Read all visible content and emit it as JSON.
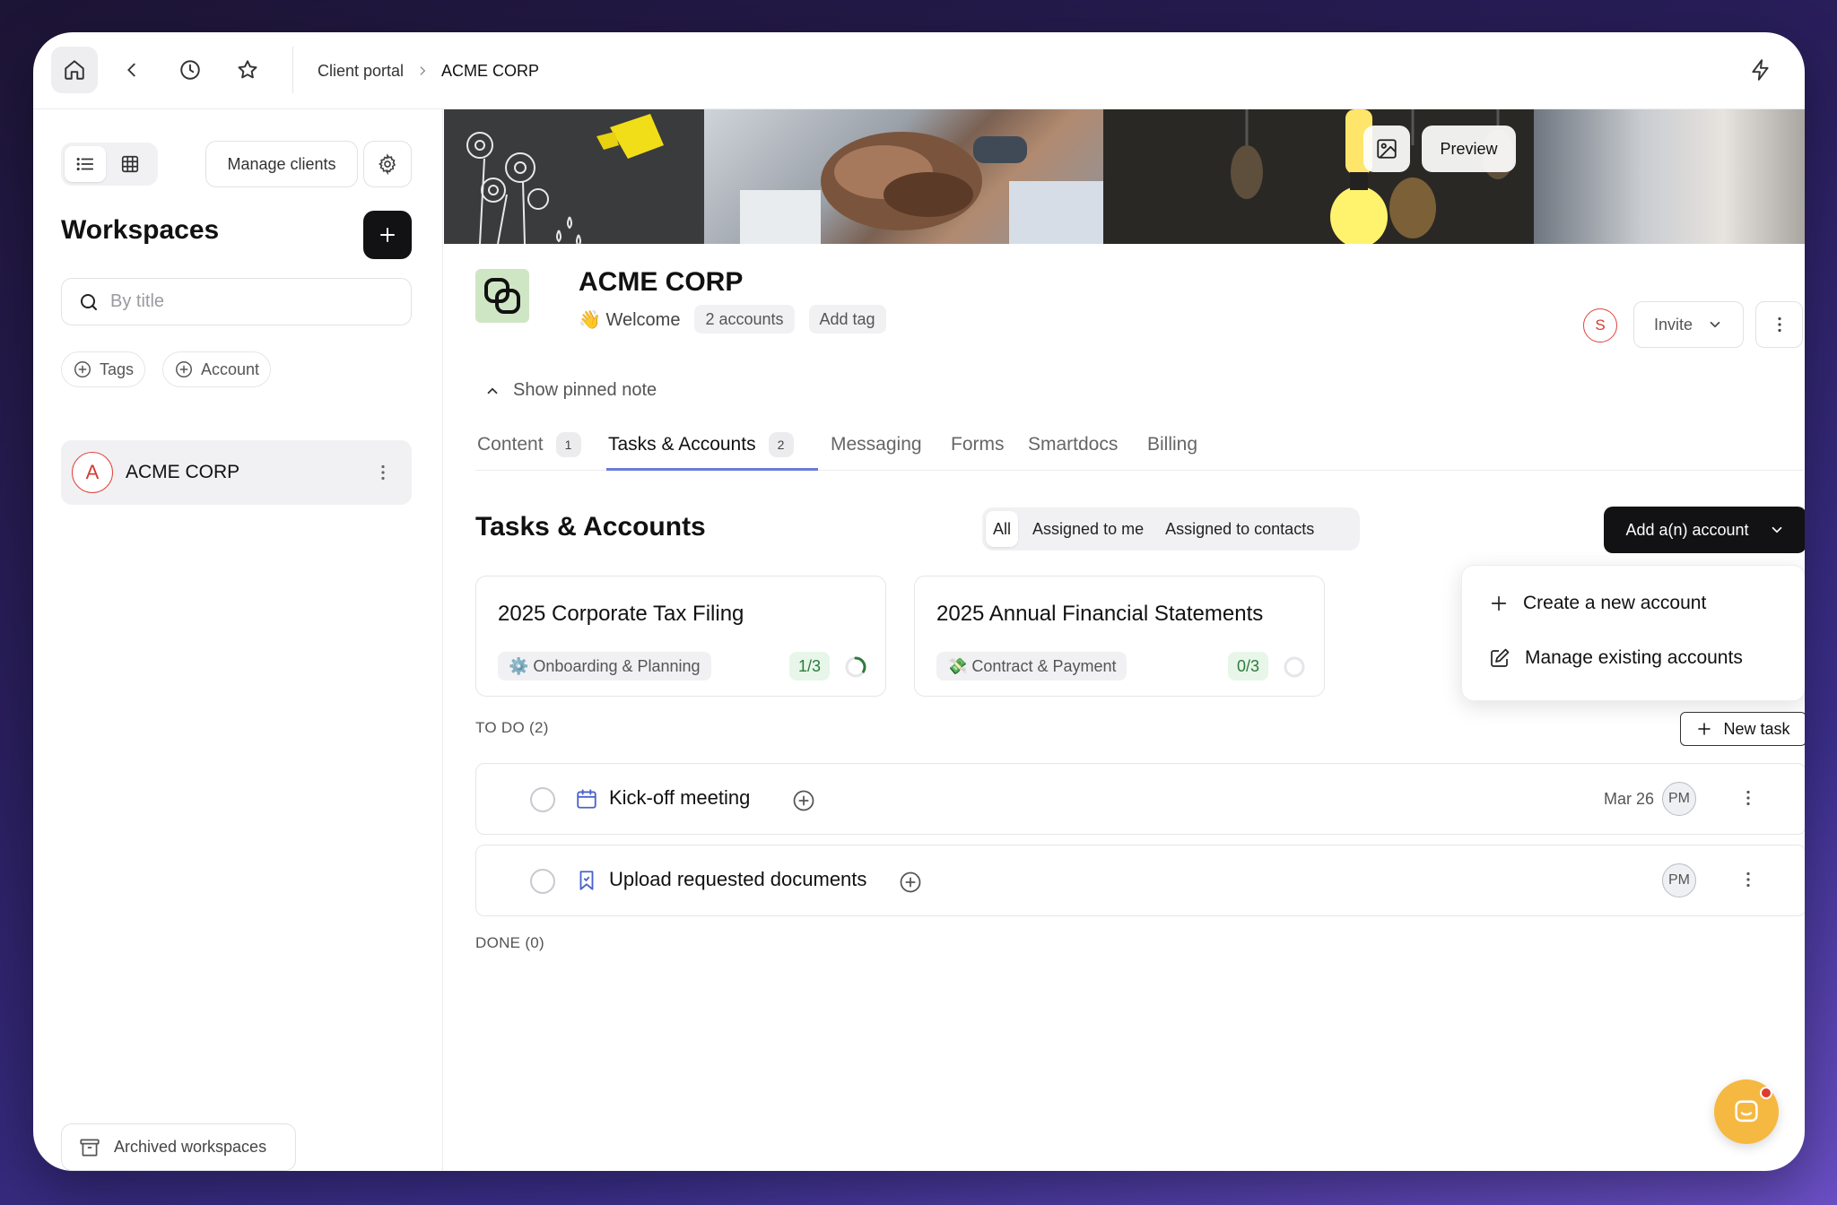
{
  "topbar": {
    "breadcrumb": [
      "Client portal",
      "ACME CORP"
    ]
  },
  "sidebar": {
    "manage_clients": "Manage clients",
    "title": "Workspaces",
    "search_placeholder": "By title",
    "filters": [
      "Tags",
      "Account"
    ],
    "workspaces": [
      {
        "initial": "A",
        "name": "ACME CORP"
      }
    ],
    "archived": "Archived workspaces"
  },
  "banner": {
    "preview": "Preview"
  },
  "client": {
    "name": "ACME CORP",
    "welcome": "👋 Welcome",
    "accounts_pill": "2 accounts",
    "add_tag": "Add tag",
    "avatar_initial": "S",
    "invite": "Invite",
    "pinned_note": "Show pinned note"
  },
  "tabs": [
    {
      "label": "Content",
      "count": "1"
    },
    {
      "label": "Tasks & Accounts",
      "count": "2"
    },
    {
      "label": "Messaging"
    },
    {
      "label": "Forms"
    },
    {
      "label": "Smartdocs"
    },
    {
      "label": "Billing"
    }
  ],
  "section": {
    "title": "Tasks & Accounts",
    "filters": [
      "All",
      "Assigned to me",
      "Assigned to contacts"
    ],
    "add_account": "Add a(n) account"
  },
  "accounts": [
    {
      "title": "2025 Corporate Tax Filing",
      "phase": "⚙️ Onboarding & Planning",
      "progress": "1/3",
      "fraction": 0.333
    },
    {
      "title": "2025 Annual Financial Statements",
      "phase": "💸 Contract & Payment",
      "progress": "0/3",
      "fraction": 0
    }
  ],
  "dropdown": {
    "create": "Create a new account",
    "manage": "Manage existing accounts"
  },
  "todo": {
    "label": "TO DO (2)",
    "new_task": "New task",
    "tasks": [
      {
        "name": "Kick-off meeting",
        "due": "Mar 26",
        "assignee": "PM",
        "icon": "calendar-icon"
      },
      {
        "name": "Upload requested documents",
        "due": "",
        "assignee": "PM",
        "icon": "bookmark-icon"
      }
    ]
  },
  "done": {
    "label": "DONE (0)"
  },
  "colors": {
    "accent": "#6b7bd9",
    "danger": "#e0443e",
    "chat": "#f5b841",
    "dark": "#121214"
  }
}
